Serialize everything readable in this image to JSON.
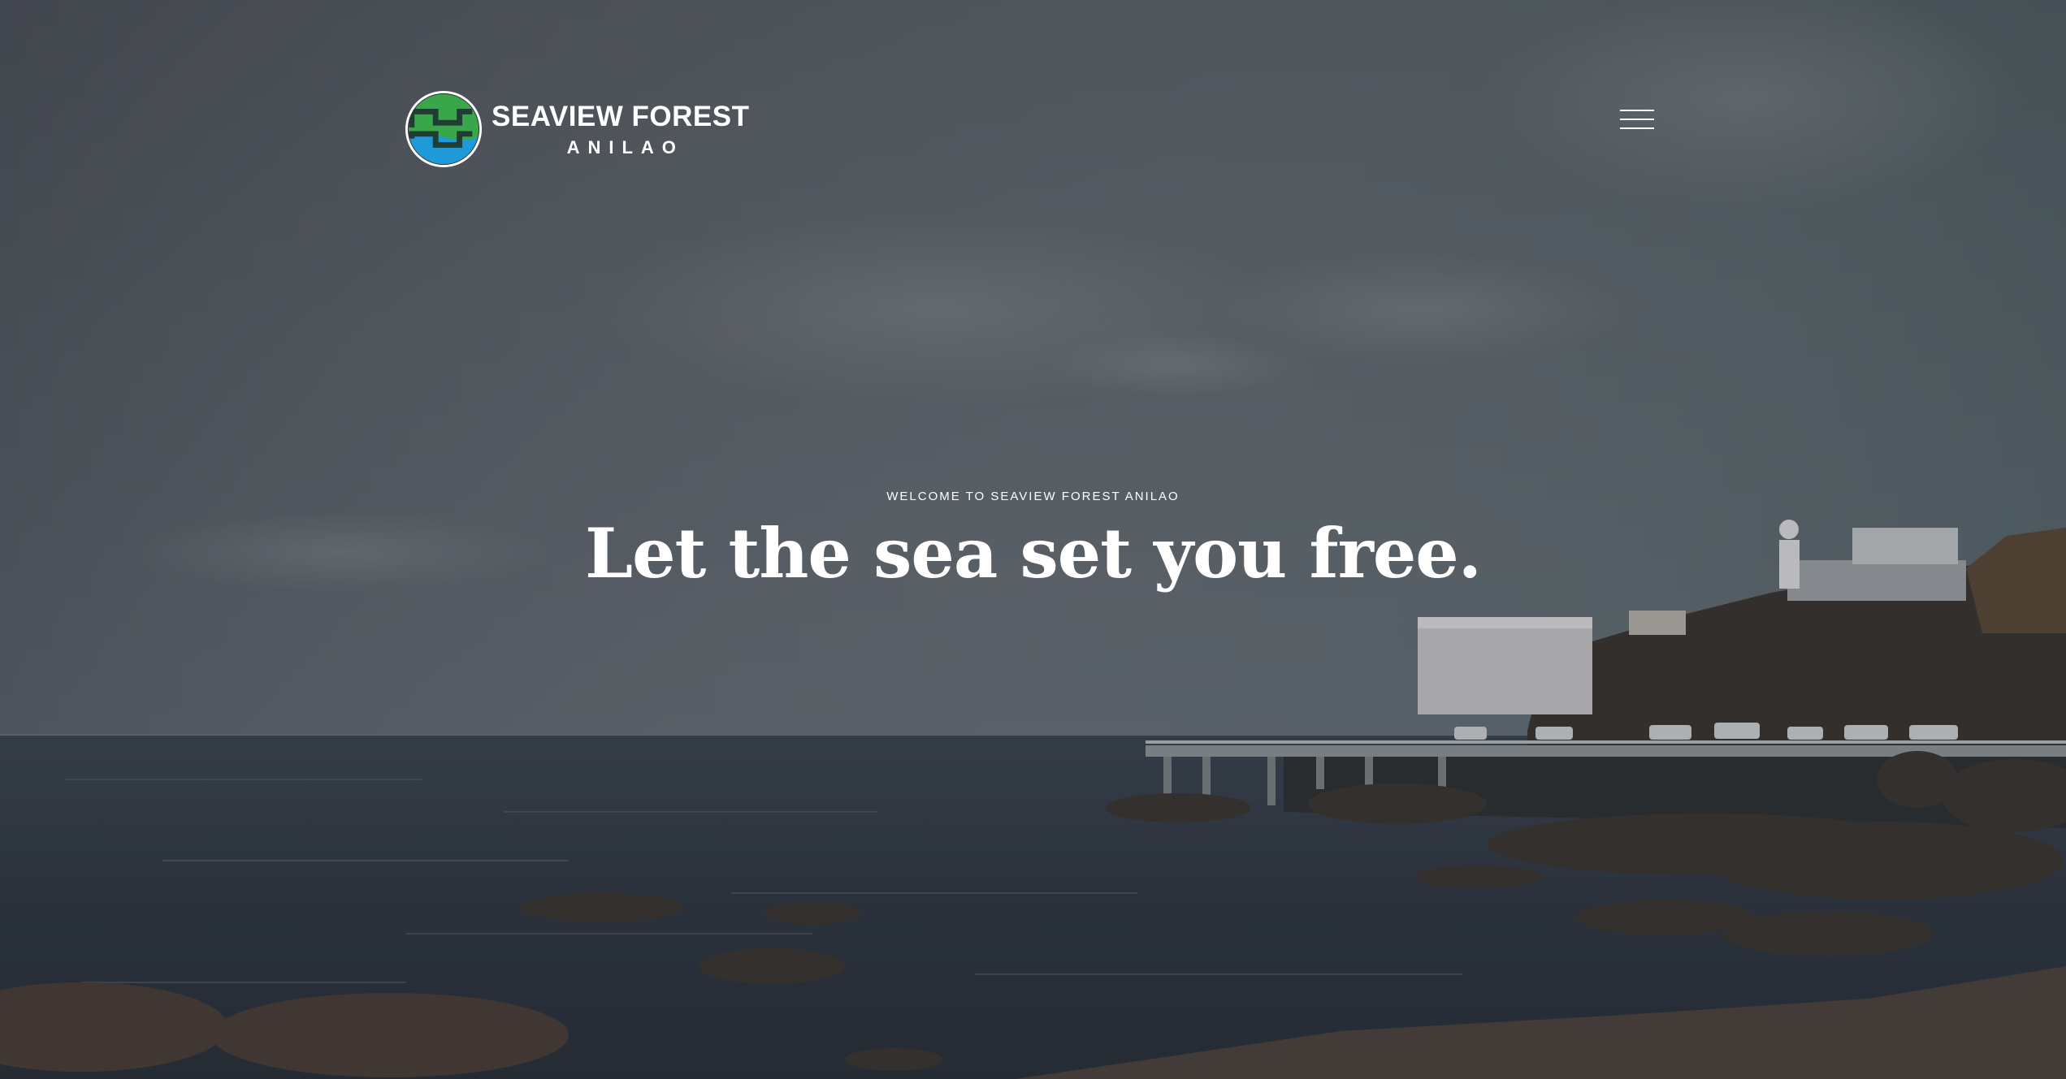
{
  "brand": {
    "name": "SEAVIEW FOREST",
    "sub": "ANILAO",
    "logo_icon": "seaview-forest-logo",
    "colors": {
      "green": "#3aa64a",
      "blue": "#1f9ad6",
      "dark": "#1f3d32"
    }
  },
  "nav": {
    "menu_icon": "hamburger-menu-icon"
  },
  "hero": {
    "tagline": "WELCOME TO SEAVIEW FOREST ANILAO",
    "headline": "Let the sea set you free.",
    "background": "seaside-pier-photo"
  }
}
